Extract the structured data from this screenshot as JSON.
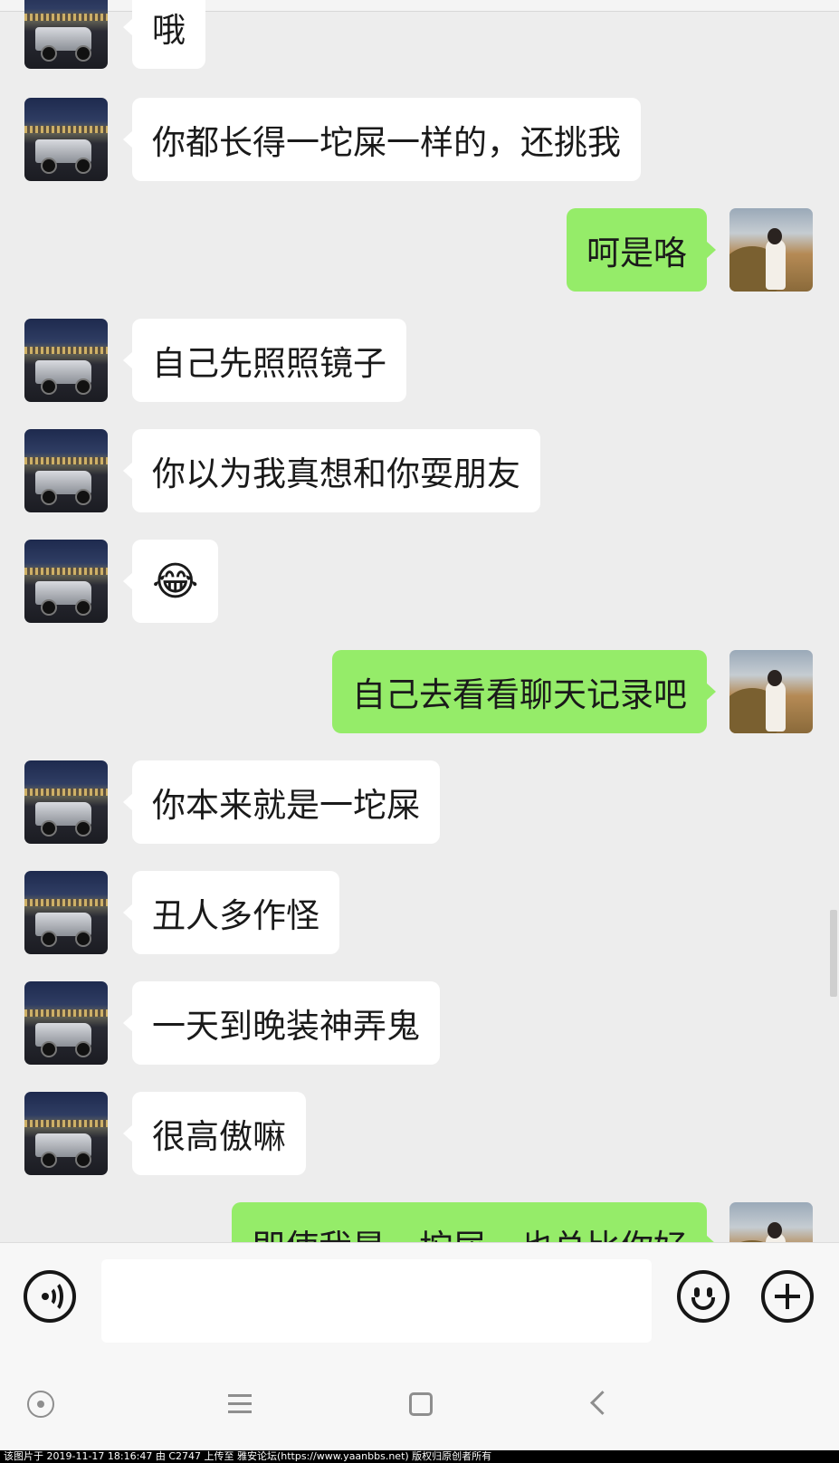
{
  "messages": [
    {
      "side": "in",
      "text": "哦"
    },
    {
      "side": "in",
      "text": "你都长得一坨屎一样的，还挑我"
    },
    {
      "side": "out",
      "text": "呵是咯"
    },
    {
      "side": "in",
      "text": "自己先照照镜子"
    },
    {
      "side": "in",
      "text": "你以为我真想和你耍朋友"
    },
    {
      "side": "in",
      "text": "😂"
    },
    {
      "side": "out",
      "text": "自己去看看聊天记录吧"
    },
    {
      "side": "in",
      "text": "你本来就是一坨屎"
    },
    {
      "side": "in",
      "text": "丑人多作怪"
    },
    {
      "side": "in",
      "text": "一天到晚装神弄鬼"
    },
    {
      "side": "in",
      "text": "很高傲嘛"
    },
    {
      "side": "out",
      "text": "即使我是一坨屎，也总比你好"
    }
  ],
  "input": {
    "value": ""
  },
  "icons": {
    "voice": "voice-icon",
    "emoji": "emoji-icon",
    "plus": "plus-icon",
    "nav_dot": "circle-dot-icon",
    "nav_menu": "menu-icon",
    "nav_home": "square-icon",
    "nav_back": "back-chevron-icon"
  },
  "colors": {
    "background": "#ededed",
    "bubble_in": "#ffffff",
    "bubble_out": "#95ec69",
    "input_bar": "#f7f7f7",
    "footer": "#000000"
  },
  "footer": {
    "watermark": "该图片于 2019-11-17 18:16:47 由 C2747 上传至 雅安论坛(https://www.yaanbbs.net) 版权归原创者所有"
  }
}
